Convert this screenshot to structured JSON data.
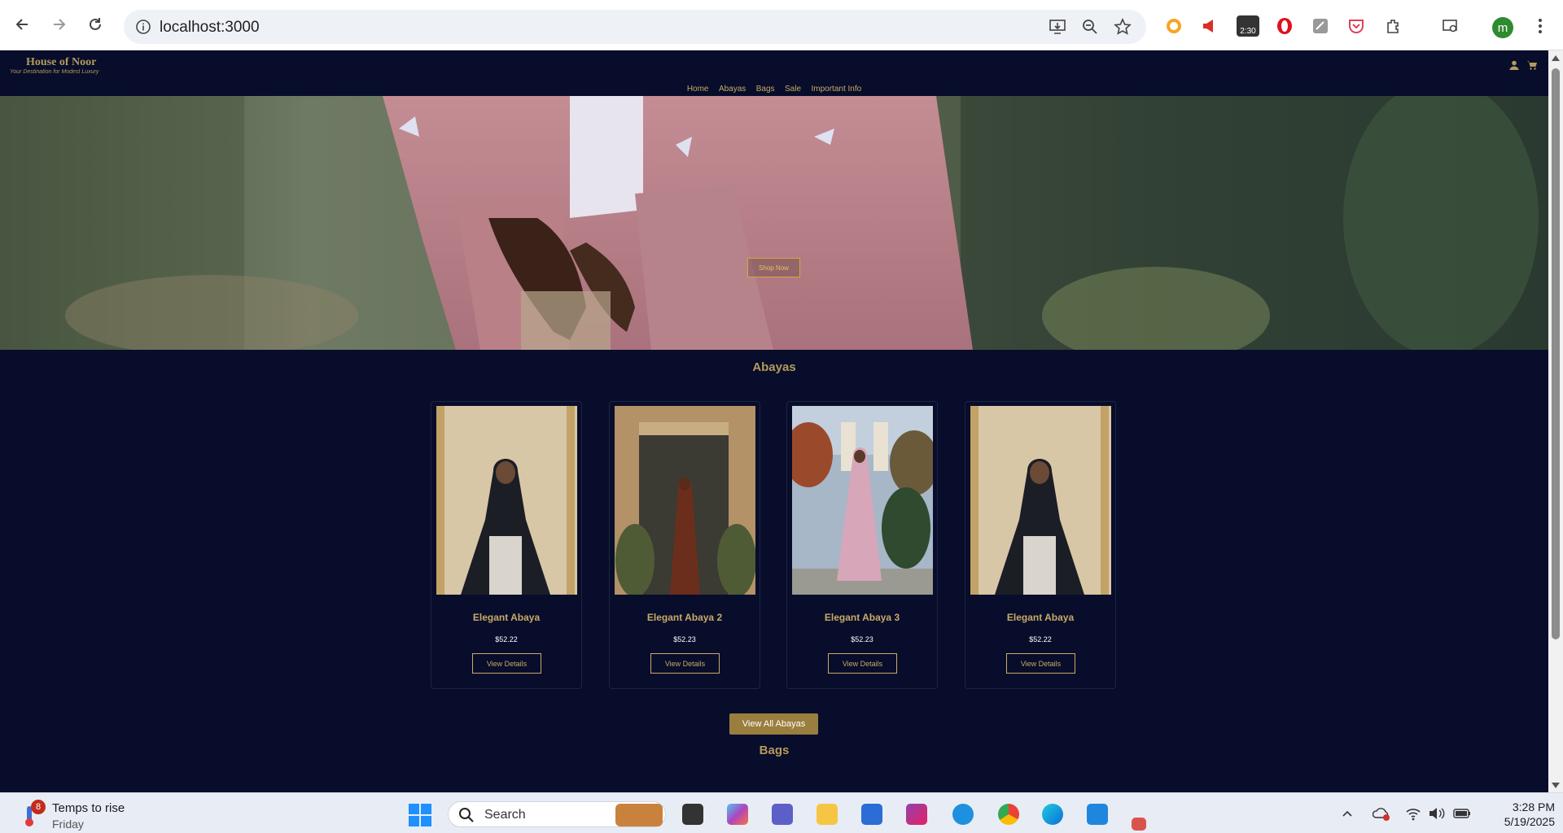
{
  "browser": {
    "url": "localhost:3000",
    "badge_time": "2:30",
    "profile_initial": "m"
  },
  "site": {
    "brand": "House of Noor",
    "tagline": "Your Destination for Modest Luxury",
    "nav": [
      "Home",
      "Abayas",
      "Bags",
      "Sale",
      "Important Info"
    ],
    "hero_cta": "Shop Now"
  },
  "abayas_section": {
    "title": "Abayas",
    "products": [
      {
        "name": "Elegant Abaya",
        "price": "$52.22",
        "button": "View Details"
      },
      {
        "name": "Elegant Abaya 2",
        "price": "$52.23",
        "button": "View Details"
      },
      {
        "name": "Elegant Abaya 3",
        "price": "$52.23",
        "button": "View Details"
      },
      {
        "name": "Elegant Abaya",
        "price": "$52.22",
        "button": "View Details"
      }
    ],
    "view_all": "View All Abayas"
  },
  "bags_section": {
    "title": "Bags"
  },
  "taskbar": {
    "weather_badge": "8",
    "weather_title": "Temps to rise",
    "weather_day": "Friday",
    "search_label": "Search",
    "time": "3:28 PM",
    "date": "5/19/2025"
  },
  "colors": {
    "page_bg": "#070d2a",
    "gold": "#c9aa67",
    "button_gold": "#9a7e3e"
  }
}
